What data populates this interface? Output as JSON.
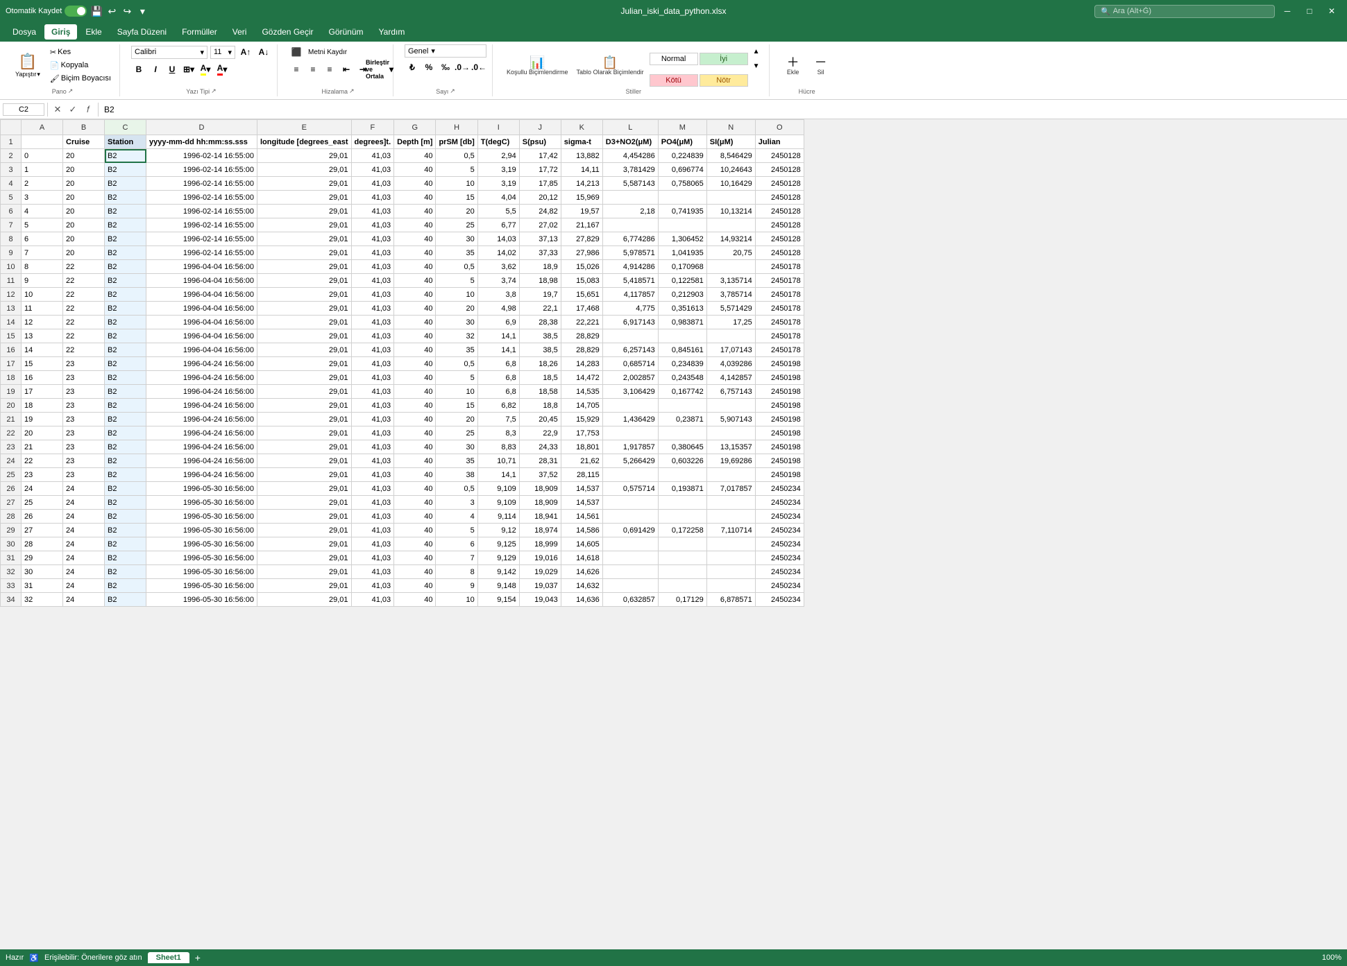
{
  "titlebar": {
    "autosave_label": "Otomatik Kaydet",
    "filename": "Julian_iski_data_python.xlsx",
    "search_placeholder": "Ara (Alt+Ğ)",
    "undo_icon": "↩",
    "redo_icon": "↪",
    "save_icon": "💾"
  },
  "menu": {
    "items": [
      "Dosya",
      "Giriş",
      "Ekle",
      "Sayfa Düzeni",
      "Formüller",
      "Veri",
      "Gözden Geçir",
      "Görünüm",
      "Yardım"
    ]
  },
  "ribbon": {
    "groups": {
      "pano": {
        "label": "Pano",
        "paste_label": "Yapıştır",
        "kes_label": "Kes",
        "kopyala_label": "Kopyala",
        "bicim_label": "Biçim Boyacısı"
      },
      "yazitipi": {
        "label": "Yazı Tipi",
        "font_name": "Calibri",
        "font_size": "11"
      },
      "hizalama": {
        "label": "Hizalama",
        "merge_label": "Birleştir ve Ortala",
        "wrap_label": "Metni Kaydır"
      },
      "sayi": {
        "label": "Sayı",
        "format": "Genel"
      },
      "stiller": {
        "label": "Stiller",
        "kosullu_label": "Koşullu Biçimlendirme",
        "tablo_label": "Tablo Olarak Biçimlendir",
        "normal_label": "Normal",
        "iyi_label": "İyi",
        "kotu_label": "Kötü",
        "notr_label": "Nötr"
      },
      "hucreler": {
        "label": "Hücre",
        "ekle_label": "Ekle",
        "sil_label": "Sil"
      }
    }
  },
  "formulabar": {
    "cell_ref": "C2",
    "formula": "B2"
  },
  "columns": {
    "headers": [
      "",
      "B",
      "C",
      "D",
      "E",
      "F",
      "G",
      "H",
      "I",
      "J",
      "K",
      "L",
      "M",
      "N",
      "O"
    ],
    "col_labels": [
      "A",
      "B",
      "C",
      "D",
      "E",
      "F",
      "G",
      "H",
      "I",
      "J",
      "K",
      "L",
      "M",
      "N",
      "O"
    ]
  },
  "header_row": {
    "cells": [
      "",
      "Cruise",
      "Station",
      "yyyy-mm-dd hh:mm:ss.sss",
      "longitude [degrees_east",
      "degrees]t.",
      "Depth [m]",
      "prSM [db]",
      "T(degC)",
      "S(psu)",
      "sigma-t",
      "D3+NO2(μM)",
      "PO4(μM)",
      "SI(μM)",
      "Julian"
    ]
  },
  "rows": [
    {
      "num": 2,
      "cells": [
        "0",
        "20",
        "B2",
        "1996-02-14 16:55:00",
        "29,01",
        "41,03",
        "40",
        "0,5",
        "2,94",
        "17,42",
        "13,882",
        "4,454286",
        "0,224839",
        "8,546429",
        "2450128"
      ]
    },
    {
      "num": 3,
      "cells": [
        "1",
        "20",
        "B2",
        "1996-02-14 16:55:00",
        "29,01",
        "41,03",
        "40",
        "5",
        "3,19",
        "17,72",
        "14,11",
        "3,781429",
        "0,696774",
        "10,24643",
        "2450128"
      ]
    },
    {
      "num": 4,
      "cells": [
        "2",
        "20",
        "B2",
        "1996-02-14 16:55:00",
        "29,01",
        "41,03",
        "40",
        "10",
        "3,19",
        "17,85",
        "14,213",
        "5,587143",
        "0,758065",
        "10,16429",
        "2450128"
      ]
    },
    {
      "num": 5,
      "cells": [
        "3",
        "20",
        "B2",
        "1996-02-14 16:55:00",
        "29,01",
        "41,03",
        "40",
        "15",
        "4,04",
        "20,12",
        "15,969",
        "",
        "",
        "",
        "2450128"
      ]
    },
    {
      "num": 6,
      "cells": [
        "4",
        "20",
        "B2",
        "1996-02-14 16:55:00",
        "29,01",
        "41,03",
        "40",
        "20",
        "5,5",
        "24,82",
        "19,57",
        "2,18",
        "0,741935",
        "10,13214",
        "2450128"
      ]
    },
    {
      "num": 7,
      "cells": [
        "5",
        "20",
        "B2",
        "1996-02-14 16:55:00",
        "29,01",
        "41,03",
        "40",
        "25",
        "6,77",
        "27,02",
        "21,167",
        "",
        "",
        "",
        "2450128"
      ]
    },
    {
      "num": 8,
      "cells": [
        "6",
        "20",
        "B2",
        "1996-02-14 16:55:00",
        "29,01",
        "41,03",
        "40",
        "30",
        "14,03",
        "37,13",
        "27,829",
        "6,774286",
        "1,306452",
        "14,93214",
        "2450128"
      ]
    },
    {
      "num": 9,
      "cells": [
        "7",
        "20",
        "B2",
        "1996-02-14 16:55:00",
        "29,01",
        "41,03",
        "40",
        "35",
        "14,02",
        "37,33",
        "27,986",
        "5,978571",
        "1,041935",
        "20,75",
        "2450128"
      ]
    },
    {
      "num": 10,
      "cells": [
        "8",
        "22",
        "B2",
        "1996-04-04 16:56:00",
        "29,01",
        "41,03",
        "40",
        "0,5",
        "3,62",
        "18,9",
        "15,026",
        "4,914286",
        "0,170968",
        "",
        "2450178"
      ]
    },
    {
      "num": 11,
      "cells": [
        "9",
        "22",
        "B2",
        "1996-04-04 16:56:00",
        "29,01",
        "41,03",
        "40",
        "5",
        "3,74",
        "18,98",
        "15,083",
        "5,418571",
        "0,122581",
        "3,135714",
        "2450178"
      ]
    },
    {
      "num": 12,
      "cells": [
        "10",
        "22",
        "B2",
        "1996-04-04 16:56:00",
        "29,01",
        "41,03",
        "40",
        "10",
        "3,8",
        "19,7",
        "15,651",
        "4,117857",
        "0,212903",
        "3,785714",
        "2450178"
      ]
    },
    {
      "num": 13,
      "cells": [
        "11",
        "22",
        "B2",
        "1996-04-04 16:56:00",
        "29,01",
        "41,03",
        "40",
        "20",
        "4,98",
        "22,1",
        "17,468",
        "4,775",
        "0,351613",
        "5,571429",
        "2450178"
      ]
    },
    {
      "num": 14,
      "cells": [
        "12",
        "22",
        "B2",
        "1996-04-04 16:56:00",
        "29,01",
        "41,03",
        "40",
        "30",
        "6,9",
        "28,38",
        "22,221",
        "6,917143",
        "0,983871",
        "17,25",
        "2450178"
      ]
    },
    {
      "num": 15,
      "cells": [
        "13",
        "22",
        "B2",
        "1996-04-04 16:56:00",
        "29,01",
        "41,03",
        "40",
        "32",
        "14,1",
        "38,5",
        "28,829",
        "",
        "",
        "",
        "2450178"
      ]
    },
    {
      "num": 16,
      "cells": [
        "14",
        "22",
        "B2",
        "1996-04-04 16:56:00",
        "29,01",
        "41,03",
        "40",
        "35",
        "14,1",
        "38,5",
        "28,829",
        "6,257143",
        "0,845161",
        "17,07143",
        "2450178"
      ]
    },
    {
      "num": 17,
      "cells": [
        "15",
        "23",
        "B2",
        "1996-04-24 16:56:00",
        "29,01",
        "41,03",
        "40",
        "0,5",
        "6,8",
        "18,26",
        "14,283",
        "0,685714",
        "0,234839",
        "4,039286",
        "2450198"
      ]
    },
    {
      "num": 18,
      "cells": [
        "16",
        "23",
        "B2",
        "1996-04-24 16:56:00",
        "29,01",
        "41,03",
        "40",
        "5",
        "6,8",
        "18,5",
        "14,472",
        "2,002857",
        "0,243548",
        "4,142857",
        "2450198"
      ]
    },
    {
      "num": 19,
      "cells": [
        "17",
        "23",
        "B2",
        "1996-04-24 16:56:00",
        "29,01",
        "41,03",
        "40",
        "10",
        "6,8",
        "18,58",
        "14,535",
        "3,106429",
        "0,167742",
        "6,757143",
        "2450198"
      ]
    },
    {
      "num": 20,
      "cells": [
        "18",
        "23",
        "B2",
        "1996-04-24 16:56:00",
        "29,01",
        "41,03",
        "40",
        "15",
        "6,82",
        "18,8",
        "14,705",
        "",
        "",
        "",
        "2450198"
      ]
    },
    {
      "num": 21,
      "cells": [
        "19",
        "23",
        "B2",
        "1996-04-24 16:56:00",
        "29,01",
        "41,03",
        "40",
        "20",
        "7,5",
        "20,45",
        "15,929",
        "1,436429",
        "0,23871",
        "5,907143",
        "2450198"
      ]
    },
    {
      "num": 22,
      "cells": [
        "20",
        "23",
        "B2",
        "1996-04-24 16:56:00",
        "29,01",
        "41,03",
        "40",
        "25",
        "8,3",
        "22,9",
        "17,753",
        "",
        "",
        "",
        "2450198"
      ]
    },
    {
      "num": 23,
      "cells": [
        "21",
        "23",
        "B2",
        "1996-04-24 16:56:00",
        "29,01",
        "41,03",
        "40",
        "30",
        "8,83",
        "24,33",
        "18,801",
        "1,917857",
        "0,380645",
        "13,15357",
        "2450198"
      ]
    },
    {
      "num": 24,
      "cells": [
        "22",
        "23",
        "B2",
        "1996-04-24 16:56:00",
        "29,01",
        "41,03",
        "40",
        "35",
        "10,71",
        "28,31",
        "21,62",
        "5,266429",
        "0,603226",
        "19,69286",
        "2450198"
      ]
    },
    {
      "num": 25,
      "cells": [
        "23",
        "23",
        "B2",
        "1996-04-24 16:56:00",
        "29,01",
        "41,03",
        "40",
        "38",
        "14,1",
        "37,52",
        "28,115",
        "",
        "",
        "",
        "2450198"
      ]
    },
    {
      "num": 26,
      "cells": [
        "24",
        "24",
        "B2",
        "1996-05-30 16:56:00",
        "29,01",
        "41,03",
        "40",
        "0,5",
        "9,109",
        "18,909",
        "14,537",
        "0,575714",
        "0,193871",
        "7,017857",
        "2450234"
      ]
    },
    {
      "num": 27,
      "cells": [
        "25",
        "24",
        "B2",
        "1996-05-30 16:56:00",
        "29,01",
        "41,03",
        "40",
        "3",
        "9,109",
        "18,909",
        "14,537",
        "",
        "",
        "",
        "2450234"
      ]
    },
    {
      "num": 28,
      "cells": [
        "26",
        "24",
        "B2",
        "1996-05-30 16:56:00",
        "29,01",
        "41,03",
        "40",
        "4",
        "9,114",
        "18,941",
        "14,561",
        "",
        "",
        "",
        "2450234"
      ]
    },
    {
      "num": 29,
      "cells": [
        "27",
        "24",
        "B2",
        "1996-05-30 16:56:00",
        "29,01",
        "41,03",
        "40",
        "5",
        "9,12",
        "18,974",
        "14,586",
        "0,691429",
        "0,172258",
        "7,110714",
        "2450234"
      ]
    },
    {
      "num": 30,
      "cells": [
        "28",
        "24",
        "B2",
        "1996-05-30 16:56:00",
        "29,01",
        "41,03",
        "40",
        "6",
        "9,125",
        "18,999",
        "14,605",
        "",
        "",
        "",
        "2450234"
      ]
    },
    {
      "num": 31,
      "cells": [
        "29",
        "24",
        "B2",
        "1996-05-30 16:56:00",
        "29,01",
        "41,03",
        "40",
        "7",
        "9,129",
        "19,016",
        "14,618",
        "",
        "",
        "",
        "2450234"
      ]
    },
    {
      "num": 32,
      "cells": [
        "30",
        "24",
        "B2",
        "1996-05-30 16:56:00",
        "29,01",
        "41,03",
        "40",
        "8",
        "9,142",
        "19,029",
        "14,626",
        "",
        "",
        "",
        "2450234"
      ]
    },
    {
      "num": 33,
      "cells": [
        "31",
        "24",
        "B2",
        "1996-05-30 16:56:00",
        "29,01",
        "41,03",
        "40",
        "9",
        "9,148",
        "19,037",
        "14,632",
        "",
        "",
        "",
        "2450234"
      ]
    },
    {
      "num": 34,
      "cells": [
        "32",
        "24",
        "B2",
        "1996-05-30 16:56:00",
        "29,01",
        "41,03",
        "40",
        "10",
        "9,154",
        "19,043",
        "14,636",
        "0,632857",
        "0,17129",
        "6,878571",
        "2450234"
      ]
    }
  ],
  "bottombar": {
    "ready": "Hazır",
    "accessibility": "Erişilebilir: Önerilere göz atın",
    "sheet1": "Sheet1",
    "add_sheet": "+"
  }
}
